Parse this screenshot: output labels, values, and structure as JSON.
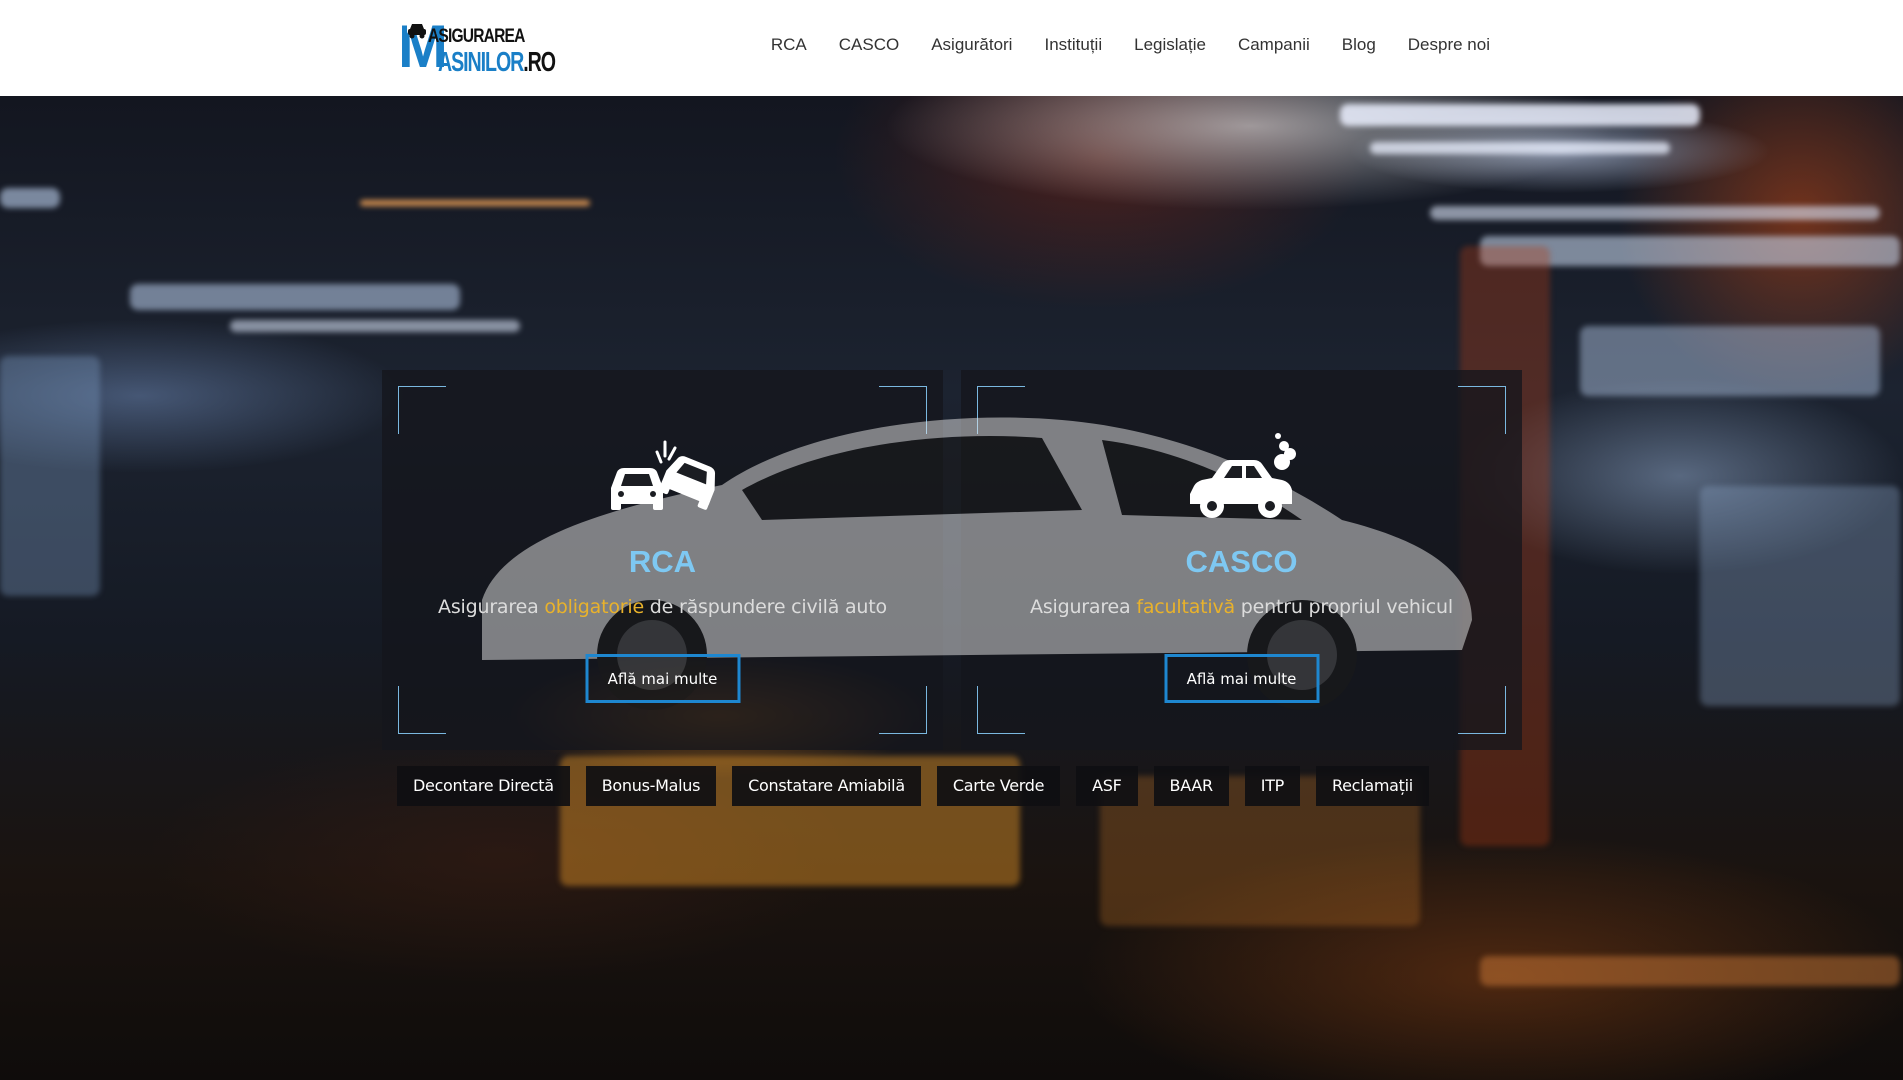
{
  "brand": {
    "logo_line1": "ASIGURAREA",
    "logo_m": "M",
    "logo_line2": "ASINILOR",
    "logo_tld": ".RO",
    "accent": "#1a7fc7"
  },
  "nav": {
    "items": [
      {
        "label": "RCA"
      },
      {
        "label": "CASCO"
      },
      {
        "label": "Asigurători"
      },
      {
        "label": "Instituții"
      },
      {
        "label": "Legislație"
      },
      {
        "label": "Campanii"
      },
      {
        "label": "Blog"
      },
      {
        "label": "Despre noi"
      }
    ]
  },
  "cards": [
    {
      "icon": "car-crash-icon",
      "title": "RCA",
      "subtitle_pre": "Asigurarea ",
      "subtitle_highlight": "obligatorie",
      "subtitle_post": " de răspundere civilă auto",
      "button": "Află mai multe"
    },
    {
      "icon": "car-exhaust-icon",
      "title": "CASCO",
      "subtitle_pre": "Asigurarea ",
      "subtitle_highlight": "facultativă",
      "subtitle_post": " pentru propriul vehicul",
      "button": "Află mai multe"
    }
  ],
  "tags": [
    {
      "label": "Decontare Directă"
    },
    {
      "label": "Bonus-Malus"
    },
    {
      "label": "Constatare Amiabilă"
    },
    {
      "label": "Carte Verde"
    },
    {
      "label": "ASF"
    },
    {
      "label": "BAAR"
    },
    {
      "label": "ITP"
    },
    {
      "label": "Reclamații"
    }
  ],
  "colors": {
    "title_blue": "#7ec8f2",
    "highlight_yellow": "#e9b22b",
    "button_border": "#1e87d0",
    "corner_lines": "#7ab8e0"
  }
}
